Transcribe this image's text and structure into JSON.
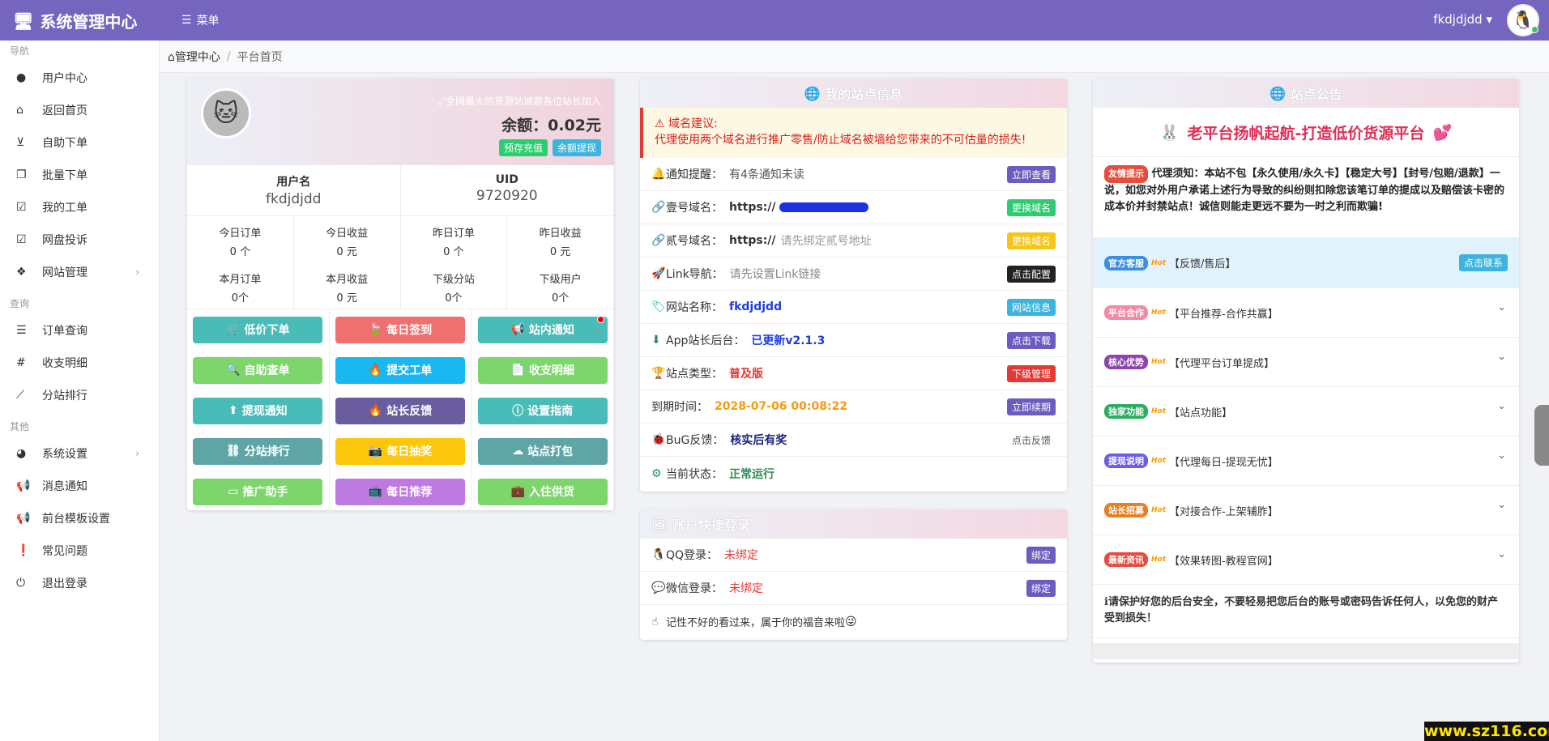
{
  "colors": {
    "accent": "#7565bf"
  },
  "header": {
    "title": "系统管理中心",
    "menu": "菜单",
    "user": "fkdjdjdd"
  },
  "breadcrumb": {
    "home": "管理中心",
    "sep": "/",
    "current": "平台首页"
  },
  "sidebar": {
    "sec1": "导航",
    "sec2": "查询",
    "sec3": "其他",
    "items1": [
      "用户中心",
      "返回首页",
      "自助下单",
      "批量下单",
      "我的工单",
      "网盘投诉",
      "网站管理"
    ],
    "items2": [
      "订单查询",
      "收支明细",
      "分站排行"
    ],
    "items3": [
      "系统设置",
      "消息通知",
      "前台模板设置",
      "常见问题",
      "退出登录"
    ]
  },
  "user": {
    "slogan": "全网最大的货源站诚邀各位站长加入",
    "balance": "余额：0.02元",
    "recharge": "预存充值",
    "withdraw": "余额提现",
    "name_label": "用户名",
    "name": "fkdjdjdd",
    "uid_label": "UID",
    "uid": "9720920",
    "stats": [
      {
        "t": "今日订单",
        "v": "0 个"
      },
      {
        "t": "今日收益",
        "v": "0 元"
      },
      {
        "t": "昨日订单",
        "v": "0 个"
      },
      {
        "t": "昨日收益",
        "v": "0 元"
      },
      {
        "t": "本月订单",
        "v": "0个"
      },
      {
        "t": "本月收益",
        "v": "0 元"
      },
      {
        "t": "下级分站",
        "v": "0个"
      },
      {
        "t": "下级用户",
        "v": "0个"
      }
    ],
    "buttons": [
      "低价下单",
      "每日签到",
      "站内通知",
      "自助查单",
      "提交工单",
      "收支明细",
      "提现通知",
      "站长反馈",
      "设置指南",
      "分站排行",
      "每日抽奖",
      "站点打包",
      "推广助手",
      "每日推荐",
      "入住供货"
    ]
  },
  "site": {
    "title": "我的站点信息",
    "alert_title": "域名建议:",
    "alert_text": "代理使用两个域名进行推广零售/防止域名被墙给您带来的不可估量的损失!",
    "rows": [
      {
        "label": "通知提醒：",
        "value": "有4条通知未读",
        "tag": "立即查看"
      },
      {
        "label": "壹号域名：",
        "value": "https://",
        "tag": "更换域名"
      },
      {
        "label": "贰号域名：",
        "value": "https://",
        "hint": "请先绑定贰号地址",
        "tag": "更换域名"
      },
      {
        "label": "Link导航：",
        "value": "请先设置Link链接",
        "tag": "点击配置"
      },
      {
        "label": "网站名称：",
        "value": "fkdjdjdd",
        "tag": "网站信息"
      },
      {
        "label": "App站长后台：",
        "value": "已更新v2.1.3",
        "tag": "点击下载"
      },
      {
        "label": "站点类型：",
        "value": "普及版",
        "tag": "下级管理"
      },
      {
        "label": "到期时间：",
        "value": "2028-07-06 00:08:22",
        "tag": "立即续期"
      },
      {
        "label": "BuG反馈：",
        "value": "核实后有奖",
        "tag": "点击反馈"
      },
      {
        "label": "当前状态：",
        "value": "正常运行"
      }
    ]
  },
  "login": {
    "title": "账户快捷登录",
    "qq_label": "QQ登录：",
    "qq_value": "未绑定",
    "qq_btn": "绑定",
    "wx_label": "微信登录：",
    "wx_value": "未绑定",
    "wx_btn": "绑定",
    "note": "记性不好的看过来，属于你的福音来啦"
  },
  "notice": {
    "title": "站点公告",
    "banner": "老平台扬帆起航-打造低价货源平台",
    "tip_label": "友情提示",
    "tip_text": "代理须知：本站不包【永久使用/永久卡】【稳定大号】【封号/包赔/退款】一说，如您对外用户承诺上述行为导致的纠纷则扣除您该笔订单的提成以及赔偿该卡密的成本价并封禁站点！诚信则能走更远不要为一时之利而欺骗!",
    "service_label": "官方客服",
    "service_text": "【反馈/售后】",
    "service_btn": "点击联系",
    "items": [
      {
        "label": "平台合作",
        "text": "【平台推荐-合作共赢】",
        "color": "#f28aa5"
      },
      {
        "label": "核心优势",
        "text": "【代理平台订单提成】",
        "color": "#8e44ad"
      },
      {
        "label": "独家功能",
        "text": "【站点功能】",
        "color": "#27ae60"
      },
      {
        "label": "提现说明",
        "text": "【代理每日-提现无忧】",
        "color": "#6c5ce7"
      },
      {
        "label": "站长招募",
        "text": "【对接合作-上架辅胙】",
        "color": "#e67e22"
      },
      {
        "label": "最新资讯",
        "text": "【效果转图-教程官网】",
        "color": "#e74c3c"
      }
    ],
    "hot": "Hot",
    "footer": "请保护好您的后台安全，不要轻易把您后台的账号或密码告诉任何人，以免您的财产受到损失！"
  },
  "watermark": "www.sz116.com"
}
